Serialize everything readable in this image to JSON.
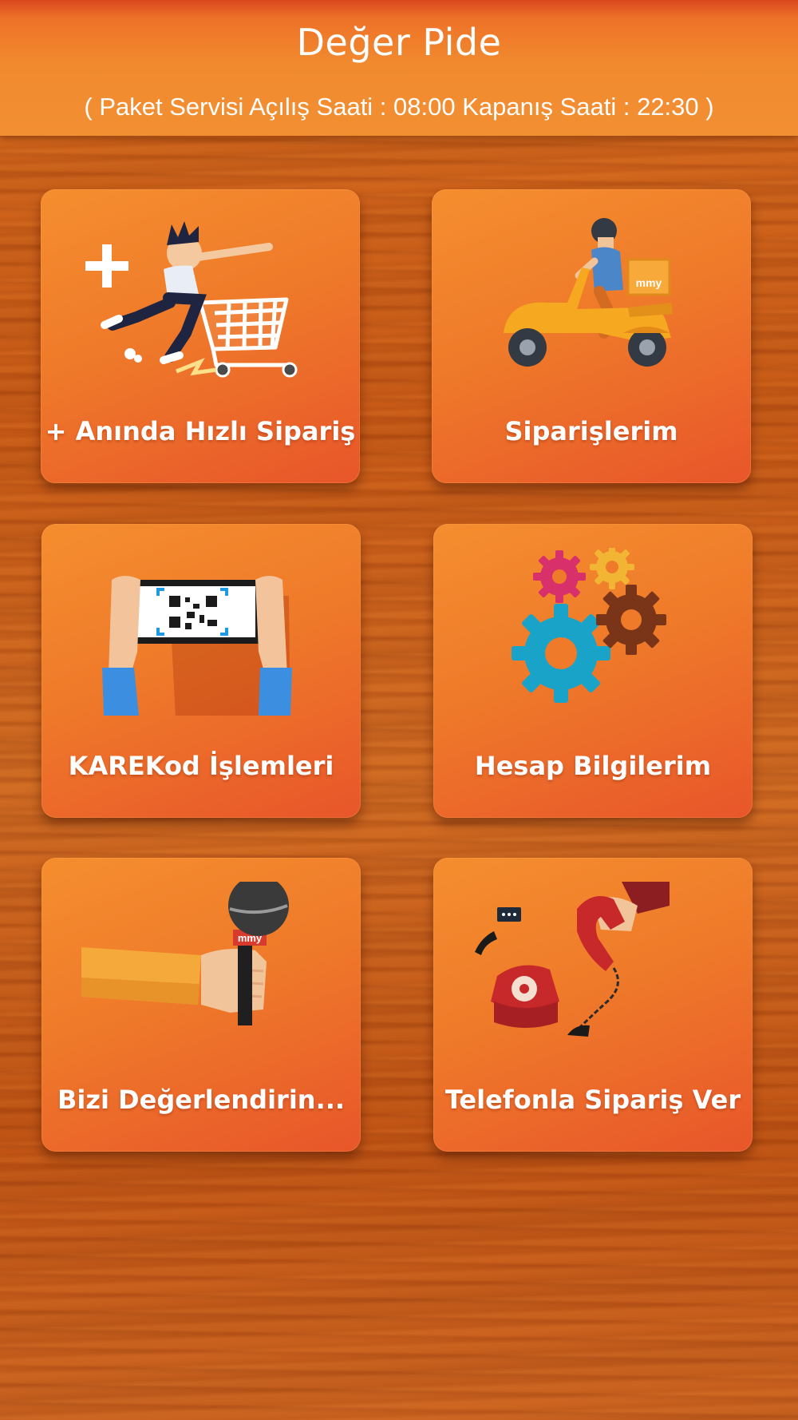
{
  "header": {
    "title": "Değer Pide",
    "hours": "( Paket Servisi Açılış Saati : 08:00 Kapanış Saati : 22:30 )"
  },
  "tiles": [
    {
      "label": "+ Anında Hızlı Sipariş",
      "icon": "shopping-cart-runner-icon"
    },
    {
      "label": "Siparişlerim",
      "icon": "delivery-scooter-icon",
      "badge": "mmy"
    },
    {
      "label": "KAREKod İşlemleri",
      "icon": "qr-code-phone-icon"
    },
    {
      "label": "Hesap Bilgilerim",
      "icon": "gears-icon"
    },
    {
      "label": "Bizi Değerlendirin...",
      "icon": "microphone-icon",
      "badge": "mmy"
    },
    {
      "label": "Telefonla Sipariş Ver",
      "icon": "telephone-icon"
    }
  ],
  "colors": {
    "header": "#f18a2e",
    "tile": "#ef7a2a",
    "wood": "#c95a16"
  }
}
